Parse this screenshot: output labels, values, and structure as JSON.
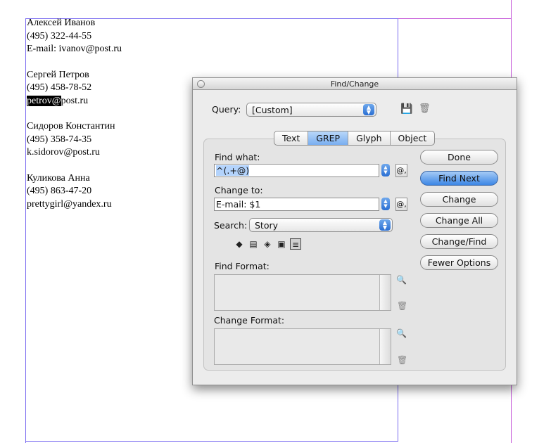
{
  "document": {
    "contacts": [
      {
        "name": "Алексей Иванов",
        "phone": "(495) 322-44-55",
        "email": "E-mail: ivanov@post.ru"
      },
      {
        "name": "Сергей Петров",
        "phone": "(495) 458-78-52",
        "email_selected": "petrov@",
        "email_rest": "post.ru"
      },
      {
        "name": "Сидоров Константин",
        "phone": "(495) 358-74-35",
        "email": "k.sidorov@post.ru"
      },
      {
        "name": "Куликова Анна",
        "phone": "(495) 863-47-20",
        "email": "prettygirl@yandex.ru"
      }
    ]
  },
  "dialog": {
    "title": "Find/Change",
    "query_label": "Query:",
    "query_value": "[Custom]",
    "tabs": [
      "Text",
      "GREP",
      "Glyph",
      "Object"
    ],
    "active_tab": "GREP",
    "find_what_label": "Find what:",
    "find_what_value": "^(.+@)",
    "change_to_label": "Change to:",
    "change_to_value": "E-mail: $1",
    "search_label": "Search:",
    "search_value": "Story",
    "find_format_label": "Find Format:",
    "change_format_label": "Change Format:",
    "buttons": {
      "done": "Done",
      "find_next": "Find Next",
      "change": "Change",
      "change_all": "Change All",
      "change_find": "Change/Find",
      "fewer_options": "Fewer Options"
    },
    "special_char_button": "@,",
    "accent_color": "#3c86e5",
    "icons": [
      "save-query-icon",
      "delete-query-icon",
      "include-locked-layers-icon",
      "include-locked-stories-icon",
      "include-hidden-layers-icon",
      "include-master-pages-icon",
      "include-footnotes-icon",
      "specify-format-icon",
      "clear-format-icon"
    ]
  }
}
